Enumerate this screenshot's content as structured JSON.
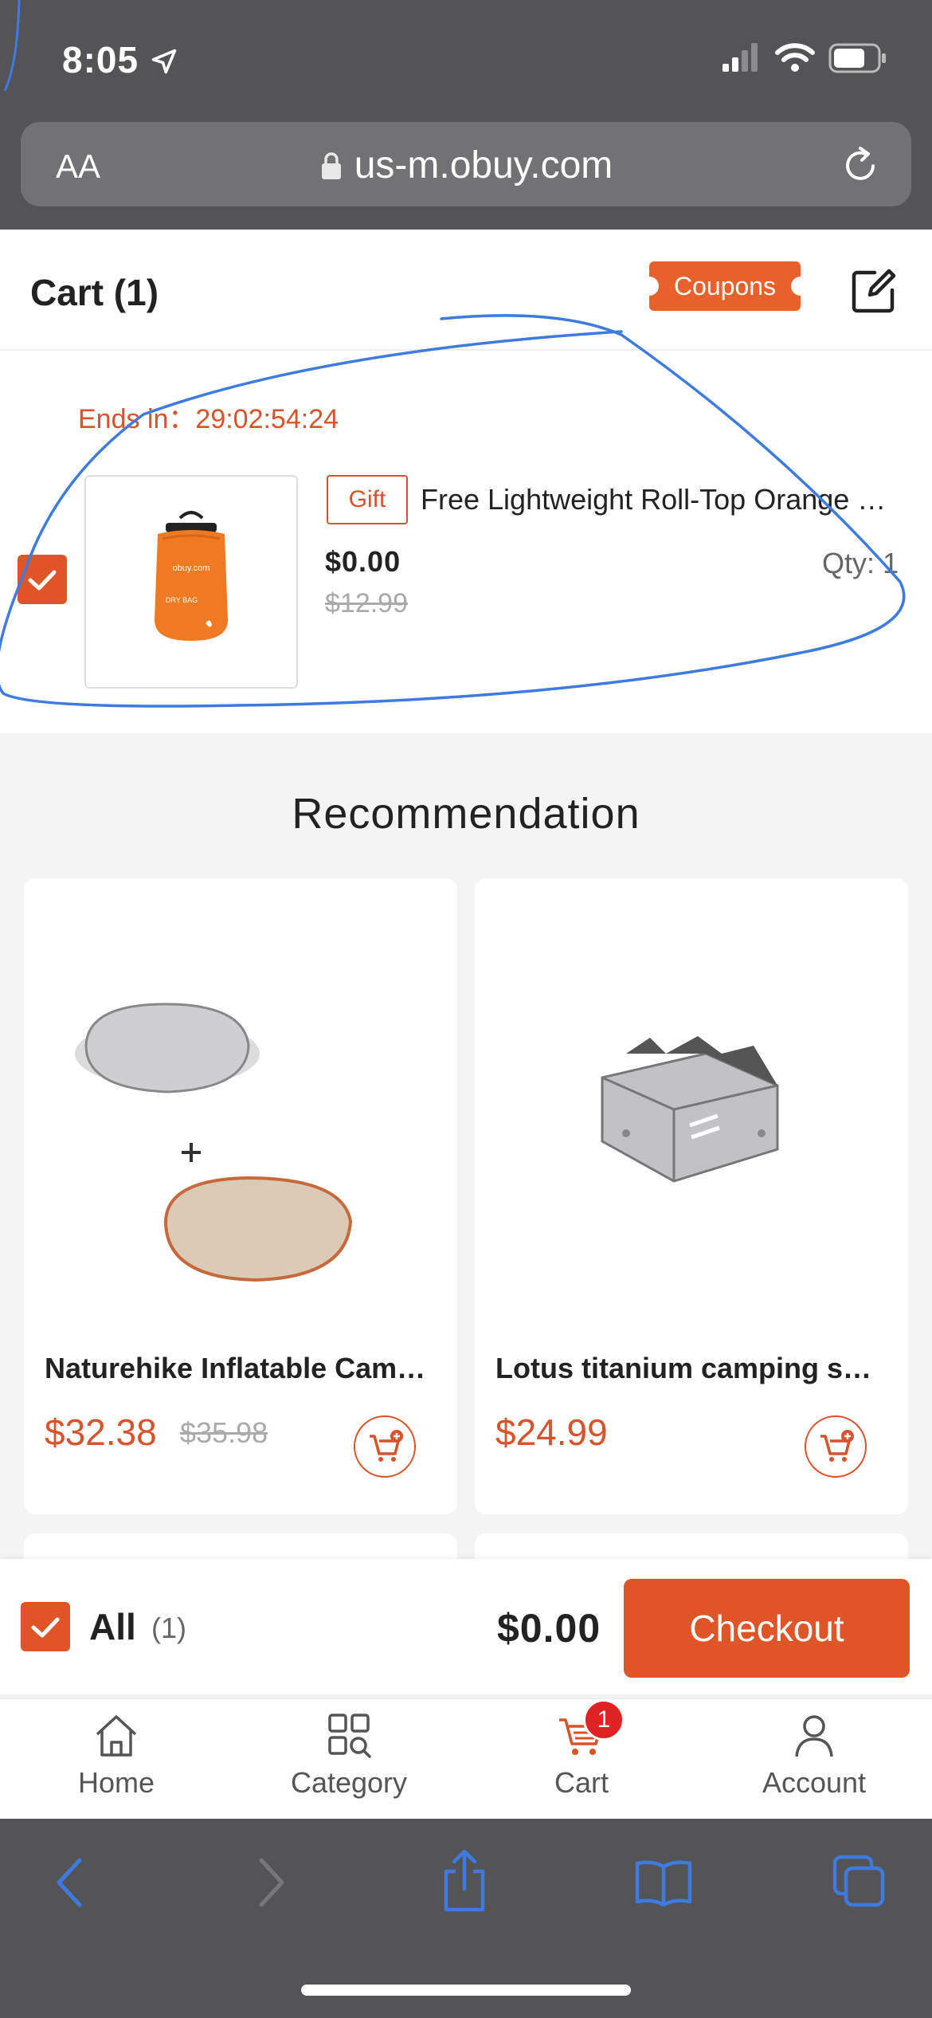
{
  "status": {
    "time": "8:05"
  },
  "browser": {
    "aa_label": "AA",
    "url": "us-m.obuy.com"
  },
  "header": {
    "title": "Cart (1)",
    "coupons_label": "Coupons"
  },
  "cart_item": {
    "countdown": "Ends in：29:02:54:24",
    "tag": "Gift",
    "name": "Free Lightweight Roll-Top Orange Dry Bag",
    "price": "$0.00",
    "old_price": "$12.99",
    "qty_label": "Qty: 1",
    "bag_brand": "obuy.com",
    "bag_text": "DRY BAG",
    "checked": true
  },
  "recommendation": {
    "title": "Recommendation",
    "products": [
      {
        "name": "Naturehike Inflatable Camping Pillow",
        "price": "$32.38",
        "old_price": "$35.98"
      },
      {
        "name": "Lotus titanium camping stove",
        "price": "$24.99",
        "old_price": ""
      }
    ]
  },
  "checkout_bar": {
    "all_label": "All",
    "all_count": "(1)",
    "total": "$0.00",
    "checkout_label": "Checkout"
  },
  "tabs": [
    {
      "label": "Home",
      "icon": "home-icon"
    },
    {
      "label": "Category",
      "icon": "category-icon"
    },
    {
      "label": "Cart",
      "icon": "cart-icon",
      "badge": "1",
      "active": true
    },
    {
      "label": "Account",
      "icon": "account-icon"
    }
  ],
  "colors": {
    "accent": "#e05528",
    "browser_chrome": "#545456",
    "link_blue": "#3d7be0"
  }
}
